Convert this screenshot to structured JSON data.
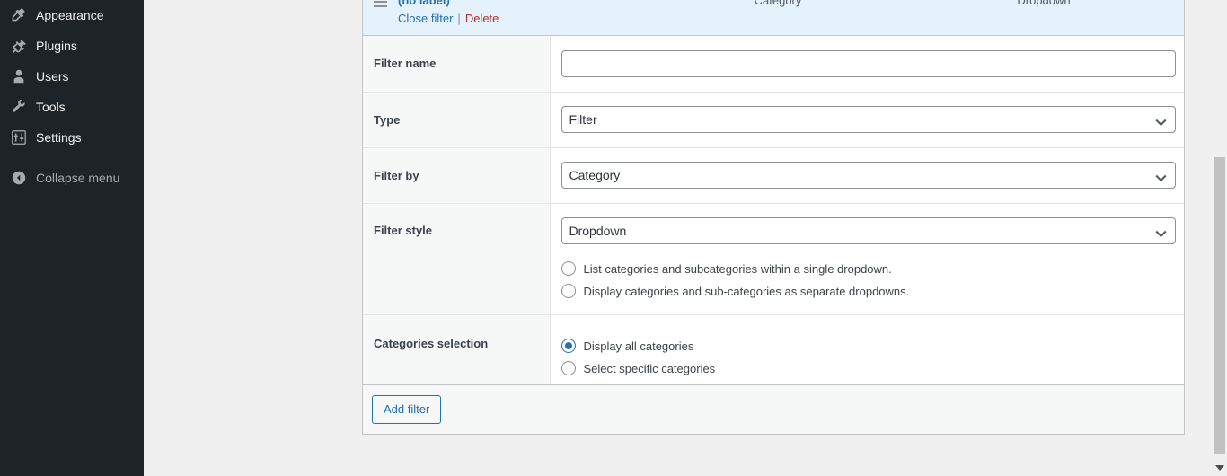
{
  "sidebar": {
    "items": [
      {
        "label": "Appearance",
        "icon": "paintbrush-icon"
      },
      {
        "label": "Plugins",
        "icon": "plug-icon"
      },
      {
        "label": "Users",
        "icon": "user-icon"
      },
      {
        "label": "Tools",
        "icon": "wrench-icon"
      },
      {
        "label": "Settings",
        "icon": "sliders-icon"
      }
    ],
    "collapse": {
      "label": "Collapse menu",
      "icon": "collapse-arrow-icon"
    }
  },
  "filter_panel": {
    "header": {
      "drag_handle_icon": "hamburger-drag-icon",
      "title": "(no label)",
      "close_link": "Close filter",
      "separator": "|",
      "delete_link": "Delete",
      "column_filter_by": "Category",
      "column_filter_style": "Dropdown"
    },
    "rows": {
      "filter_name": {
        "label": "Filter name",
        "value": "",
        "placeholder": ""
      },
      "type": {
        "label": "Type",
        "selected": "Filter",
        "options": [
          "Filter"
        ],
        "chevron_icon": "chevron-down-icon"
      },
      "filter_by": {
        "label": "Filter by",
        "selected": "Category",
        "options": [
          "Category"
        ],
        "chevron_icon": "chevron-down-icon"
      },
      "filter_style": {
        "label": "Filter style",
        "selected": "Dropdown",
        "options": [
          "Dropdown"
        ],
        "chevron_icon": "chevron-down-icon",
        "radios": [
          {
            "label": "List categories and subcategories within a single dropdown.",
            "checked": false
          },
          {
            "label": "Display categories and sub-categories as separate dropdowns.",
            "checked": false
          }
        ]
      },
      "categories_selection": {
        "label": "Categories selection",
        "radios": [
          {
            "label": "Display all categories",
            "checked": true
          },
          {
            "label": "Select specific categories",
            "checked": false
          }
        ]
      }
    },
    "footer": {
      "add_filter_label": "Add filter"
    }
  },
  "colors": {
    "sidebar_bg": "#1d2327",
    "header_bg": "#e5f1fb",
    "link_blue": "#2271b1",
    "delete_red": "#b32d2e",
    "label_bg": "#f6f7f7",
    "canvas_bg": "#f0f0f1"
  }
}
